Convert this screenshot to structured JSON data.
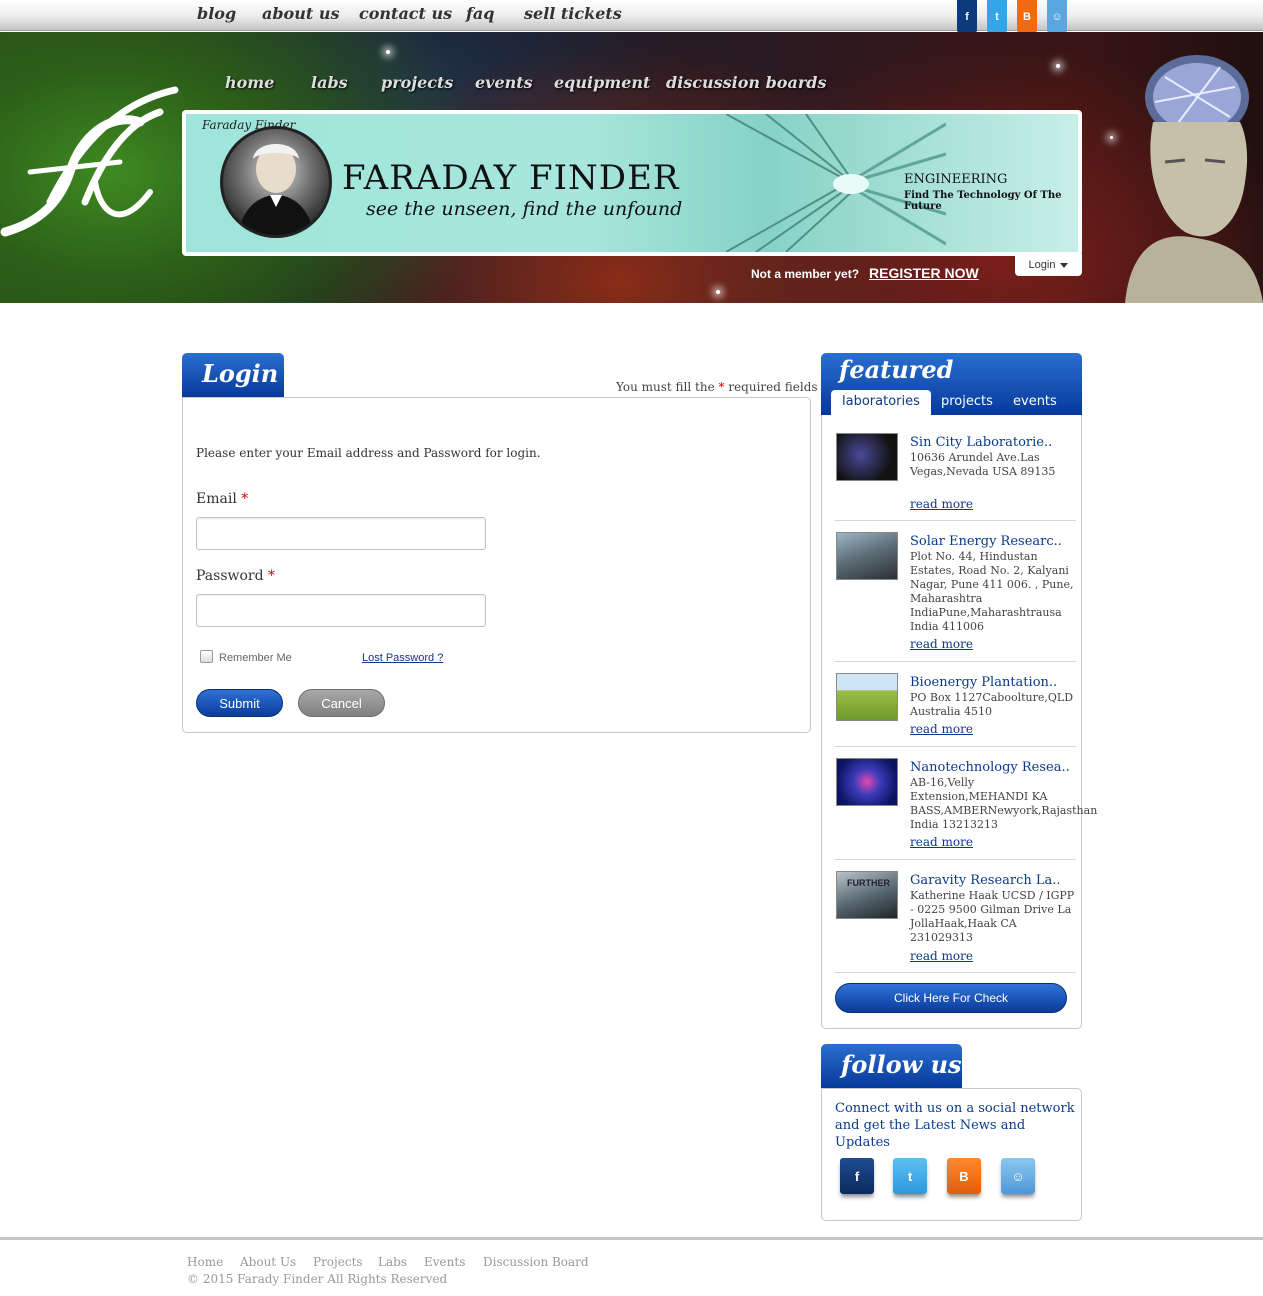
{
  "topbar": {
    "links": [
      "blog",
      "about us",
      "contact us",
      "faq",
      "sell tickets"
    ],
    "social": [
      {
        "icon": "facebook-icon",
        "glyph": "f",
        "color": "#0d3a7a"
      },
      {
        "icon": "twitter-icon",
        "glyph": "t",
        "color": "#33a6e8"
      },
      {
        "icon": "blogger-icon",
        "glyph": "B",
        "color": "#ee6b12"
      },
      {
        "icon": "reddit-icon",
        "glyph": "☺",
        "color": "#5aa6e0"
      }
    ]
  },
  "nav": {
    "items": [
      "home",
      "labs",
      "projects",
      "events",
      "equipment",
      "discussion boards"
    ]
  },
  "banner": {
    "ring_text": "Faraday Finder",
    "title": "FARADAY FINDER",
    "tagline": "see the unseen,  find the unfound",
    "side_title": "ENGINEERING",
    "side_subtitle": "Find The Technology Of The Future"
  },
  "member": {
    "prompt": "Not a member yet?",
    "register": "REGISTER NOW",
    "login": "Login"
  },
  "login": {
    "heading": "Login",
    "required_prefix": "You must fill the ",
    "required_star": "*",
    "required_suffix": " required fields",
    "intro": "Please enter your Email address and Password for login.",
    "email_label": "Email",
    "password_label": "Password",
    "required_marker": "*",
    "remember": "Remember Me",
    "lost_password": "Lost Password ?",
    "submit": "Submit",
    "cancel": "Cancel"
  },
  "featured": {
    "heading": "featured",
    "tabs": [
      "laboratories",
      "projects",
      "events"
    ],
    "active_tab": "laboratories",
    "labs": [
      {
        "title": "Sin City Laboratorie..",
        "address": "10636 Arundel Ave.Las Vegas,Nevada USA 89135",
        "more": "read more"
      },
      {
        "title": "Solar Energy Researc..",
        "address": "Plot No. 44, Hindustan Estates, Road No. 2, Kalyani Nagar, Pune 411 006. , Pune, Maharashtra IndiaPune,Maharashtrausa India 411006",
        "more": "read more"
      },
      {
        "title": "Bioenergy Plantation..",
        "address": "PO Box 1127Caboolture,QLD Australia 4510",
        "more": "read more"
      },
      {
        "title": "Nanotechnology Resea..",
        "address": "AB-16,Velly Extension,MEHANDI KA BASS,AMBERNewyork,Rajasthan India 13213213",
        "more": "read more"
      },
      {
        "title": "Garavity Research La..",
        "address": "Katherine Haak UCSD / IGPP - 0225 9500 Gilman Drive La JollaHaak,Haak CA 231029313",
        "more": "read more"
      }
    ],
    "thumb_caption": "FURTHER",
    "check_button": "Click Here For Check"
  },
  "follow": {
    "heading": "follow us",
    "text": "Connect with us on a social network and get the Latest News and Updates"
  },
  "footer": {
    "links": [
      "Home",
      "About Us",
      "Projects",
      "Labs",
      "Events",
      "Discussion Board"
    ],
    "copyright": "© 2015 Farady Finder All Rights Reserved"
  }
}
